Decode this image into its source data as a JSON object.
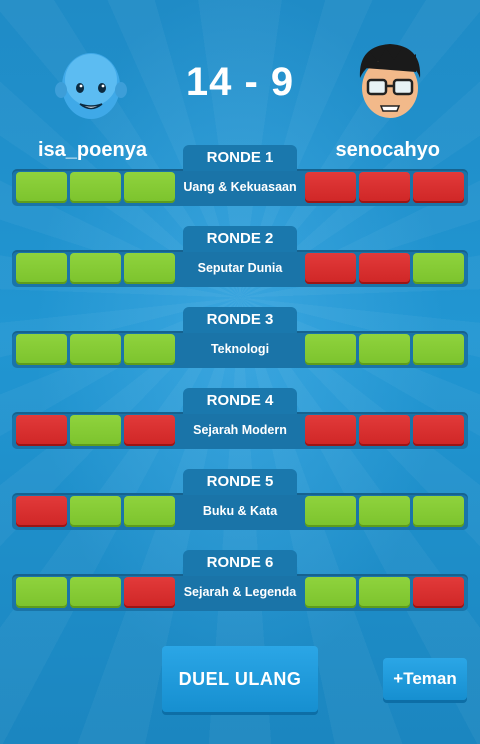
{
  "player_left": {
    "name": "isa_poenya"
  },
  "player_right": {
    "name": "senocahyo"
  },
  "score": "14 - 9",
  "rounds": [
    {
      "label": "RONDE 1",
      "category": "Uang & Kekuasaan",
      "left": [
        "correct",
        "correct",
        "correct"
      ],
      "right": [
        "wrong",
        "wrong",
        "wrong"
      ]
    },
    {
      "label": "RONDE 2",
      "category": "Seputar Dunia",
      "left": [
        "correct",
        "correct",
        "correct"
      ],
      "right": [
        "wrong",
        "wrong",
        "correct"
      ]
    },
    {
      "label": "RONDE 3",
      "category": "Teknologi",
      "left": [
        "correct",
        "correct",
        "correct"
      ],
      "right": [
        "correct",
        "correct",
        "correct"
      ]
    },
    {
      "label": "RONDE 4",
      "category": "Sejarah Modern",
      "left": [
        "wrong",
        "correct",
        "wrong"
      ],
      "right": [
        "wrong",
        "wrong",
        "wrong"
      ]
    },
    {
      "label": "RONDE 5",
      "category": "Buku & Kata",
      "left": [
        "wrong",
        "correct",
        "correct"
      ],
      "right": [
        "correct",
        "correct",
        "correct"
      ]
    },
    {
      "label": "RONDE 6",
      "category": "Sejarah & Legenda",
      "left": [
        "correct",
        "correct",
        "wrong"
      ],
      "right": [
        "correct",
        "correct",
        "wrong"
      ]
    }
  ],
  "actions": {
    "rematch_label": "DUEL ULANG",
    "add_friend_label": "+Teman"
  },
  "colors": {
    "correct": "#7cc32d",
    "wrong": "#d42b2b",
    "background": "#1e88c2"
  }
}
